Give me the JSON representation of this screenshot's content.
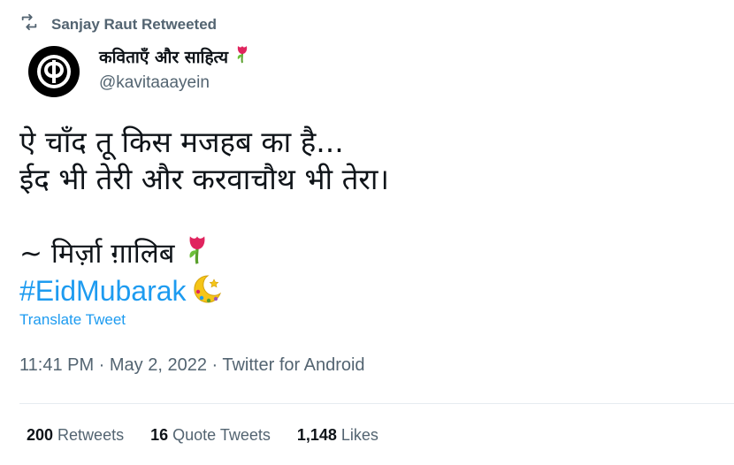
{
  "retweet": {
    "icon": "retweet-icon",
    "text": "Sanjay Raut Retweeted"
  },
  "author": {
    "avatar_icon": "dp-logo-icon",
    "display_name": "कविताएँ और साहित्य",
    "name_emoji_icon": "tulip-icon",
    "handle": "@kavitaaayein"
  },
  "tweet": {
    "line1": "ऐ चाँद तू किस मजहब का है...",
    "line2": "ईद भी तेरी और करवाचौथ भी तेरा।",
    "signature": "~ मिर्ज़ा ग़ालिब",
    "signature_emoji_icon": "tulip-icon",
    "hashtag": "#EidMubarak",
    "hashtag_emoji_icon": "crescent-moon-icon"
  },
  "translate_label": "Translate Tweet",
  "meta": "11:41 PM · May 2, 2022 · Twitter for Android",
  "stats": {
    "retweets_count": "200",
    "retweets_label": "Retweets",
    "quotes_count": "16",
    "quotes_label": "Quote Tweets",
    "likes_count": "1,148",
    "likes_label": "Likes"
  },
  "colors": {
    "link": "#1d9bf0",
    "muted": "#536471",
    "text": "#0f1419"
  }
}
